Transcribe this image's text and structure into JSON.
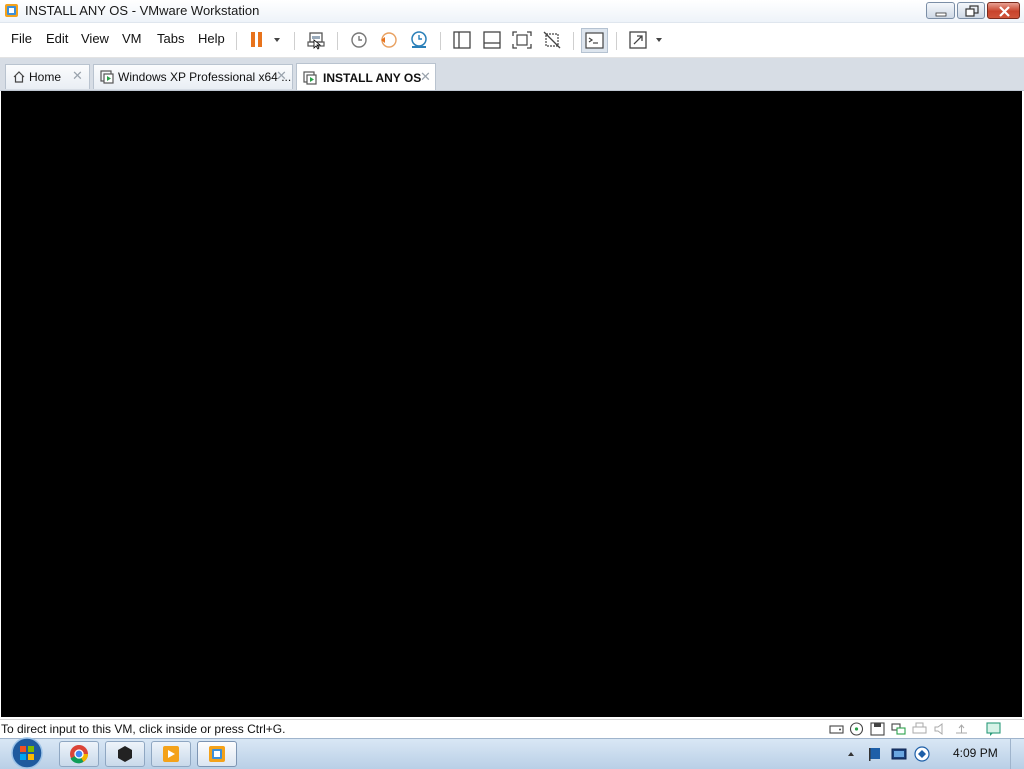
{
  "window": {
    "title": "INSTALL ANY OS - VMware Workstation"
  },
  "menu": {
    "items": [
      "File",
      "Edit",
      "View",
      "VM",
      "Tabs",
      "Help"
    ]
  },
  "toolbar": {
    "icons": [
      "pause-icon",
      "dropdown-arrow-icon",
      "send-ctrl-alt-del-icon",
      "snapshot-icon",
      "revert-snapshot-icon",
      "snapshot-manager-icon",
      "library-icon",
      "thumbnail-bar-icon",
      "full-screen-icon",
      "unity-icon",
      "console-view-icon",
      "stretch-icon",
      "dropdown-arrow-icon"
    ],
    "accent_color": "#e8731c"
  },
  "tabs": [
    {
      "label": "Home",
      "icon": "home-icon",
      "active": false
    },
    {
      "label": "Windows XP Professional x64 ...",
      "icon": "vm-icon",
      "active": false
    },
    {
      "label": "INSTALL ANY OS",
      "icon": "vm-running-icon",
      "active": true
    }
  ],
  "statusbar": {
    "message": "To direct input to this VM, click inside or press Ctrl+G."
  },
  "taskbar": {
    "apps": [
      "chrome-icon",
      "terminal-icon",
      "media-player-icon",
      "vmware-icon"
    ],
    "clock": "4:09 PM"
  }
}
